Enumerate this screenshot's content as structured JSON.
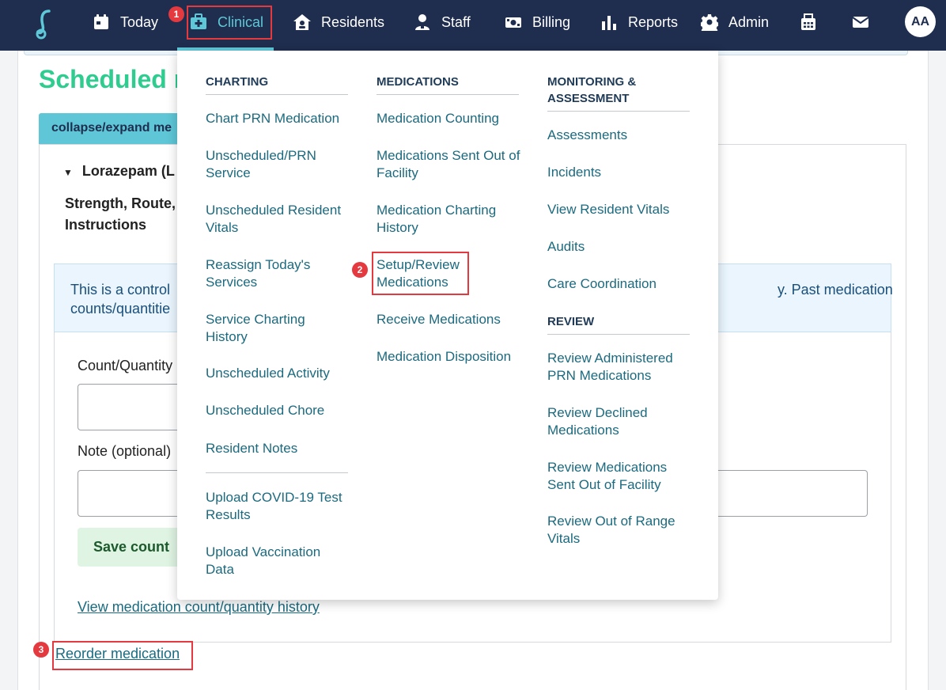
{
  "nav": {
    "items": [
      {
        "label": "Today",
        "icon": "calendar-icon"
      },
      {
        "label": "Clinical",
        "icon": "medical-kit-icon"
      },
      {
        "label": "Residents",
        "icon": "house-user-icon"
      },
      {
        "label": "Staff",
        "icon": "user-badge-icon"
      },
      {
        "label": "Billing",
        "icon": "money-icon"
      },
      {
        "label": "Reports",
        "icon": "bar-chart-icon"
      },
      {
        "label": "Admin",
        "icon": "gear-icon"
      }
    ],
    "active_index": 1,
    "avatar_initials": "AA",
    "accent_color": "#5fc8d8",
    "bar_color": "#1f2d4e"
  },
  "page": {
    "title": "Scheduled m",
    "collapse_label": "collapse/expand me",
    "med_name": "Lorazepam (L",
    "strength_label_line1": "Strength, Route,",
    "strength_label_line2": "Instructions",
    "alert_left_line1": "This is a control",
    "alert_left_line2": "counts/quantitie",
    "alert_right": "y. Past medication",
    "count_label": "Count/Quantity",
    "note_label": "Note (optional)",
    "save_label": "Save count",
    "history_link": "View medication count/quantity history",
    "reorder_link": "Reorder medication",
    "title_color": "#2ecc8f"
  },
  "menu": {
    "charting": {
      "heading": "CHARTING",
      "items": [
        "Chart PRN Medication",
        "Unscheduled/PRN Service",
        "Unscheduled Resident Vitals",
        "Reassign Today's Services",
        "Service Charting History",
        "Unscheduled Activity",
        "Unscheduled Chore",
        "Resident Notes",
        "Upload COVID-19 Test Results",
        "Upload Vaccination Data"
      ]
    },
    "medications": {
      "heading": "MEDICATIONS",
      "items": [
        "Medication Counting",
        "Medications Sent Out of Facility",
        "Medication Charting History",
        "Setup/Review Medications",
        "Receive Medications",
        "Medication Disposition"
      ]
    },
    "monitoring": {
      "heading": "MONITORING & ASSESSMENT",
      "items": [
        "Assessments",
        "Incidents",
        "View Resident Vitals",
        "Audits",
        "Care Coordination"
      ]
    },
    "review": {
      "heading": "REVIEW",
      "items": [
        "Review Administered PRN Medications",
        "Review Declined Medications",
        "Review Medications Sent Out of Facility",
        "Review Out of Range Vitals"
      ]
    }
  },
  "annotations": [
    "1",
    "2",
    "3"
  ]
}
